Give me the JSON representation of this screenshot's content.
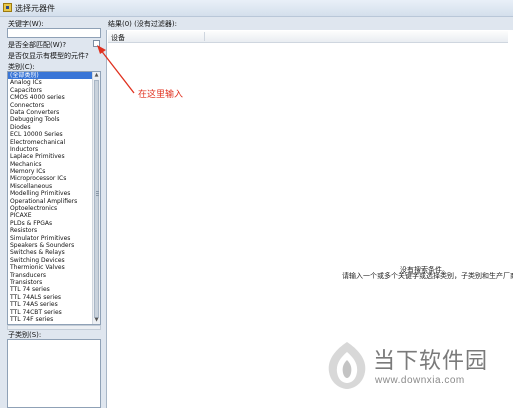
{
  "window": {
    "title": "选择元器件"
  },
  "left": {
    "keywords_label": "关键字(W):",
    "match_all_label": "是否全部匹配(W)?",
    "show_models_label": "是否仅显示有模型的元件?",
    "category_label": "类别(C):",
    "categories": [
      "(全部类别)",
      "Analog ICs",
      "Capacitors",
      "CMOS 4000 series",
      "Connectors",
      "Data Converters",
      "Debugging Tools",
      "Diodes",
      "ECL 10000 Series",
      "Electromechanical",
      "Inductors",
      "Laplace Primitives",
      "Mechanics",
      "Memory ICs",
      "Microprocessor ICs",
      "Miscellaneous",
      "Modelling Primitives",
      "Operational Amplifiers",
      "Optoelectronics",
      "PICAXE",
      "PLDs & FPGAs",
      "Resistors",
      "Simulator Primitives",
      "Speakers & Sounders",
      "Switches & Relays",
      "Switching Devices",
      "Thermionic Valves",
      "Transducers",
      "Transistors",
      "TTL 74 series",
      "TTL 74ALS series",
      "TTL 74AS series",
      "TTL 74CBT series",
      "TTL 74F series"
    ],
    "subcategory_label": "子类别(S):"
  },
  "results": {
    "header_label": "结果(0) (没有过滤器):",
    "column_label": "设备",
    "empty_line1": "没有搜索条件。",
    "empty_line2": "请输入一个或多个关键字或选择类别，子类别和生产厂商"
  },
  "annotation": {
    "text": "在这里输入",
    "color": "#e0311f"
  },
  "watermark": {
    "brand": "当下软件园",
    "url": "www.downxia.com"
  },
  "colors": {
    "selection": "#3875d7",
    "background": "#dfe6ef"
  }
}
